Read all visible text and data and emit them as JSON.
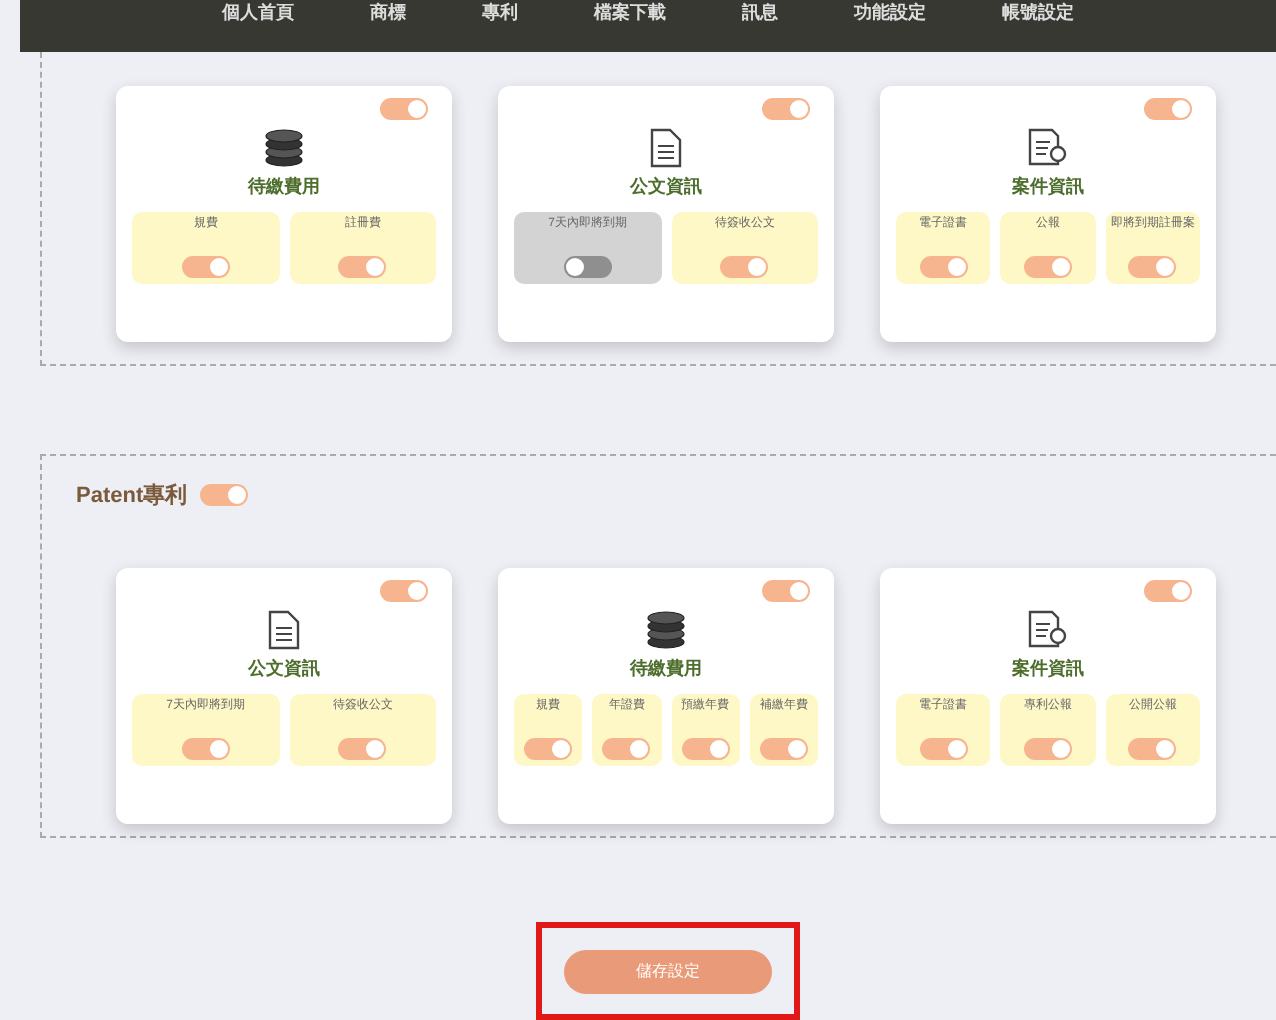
{
  "nav": [
    {
      "label": "個人首頁"
    },
    {
      "label": "商標"
    },
    {
      "label": "專利"
    },
    {
      "label": "檔案下載"
    },
    {
      "label": "訊息"
    },
    {
      "label": "功能設定"
    },
    {
      "label": "帳號設定"
    }
  ],
  "sections": [
    {
      "cards": [
        {
          "kind": "coins",
          "title": "待繳費用",
          "on": true,
          "items": [
            {
              "label": "規費",
              "on": true
            },
            {
              "label": "註冊費",
              "on": true
            }
          ]
        },
        {
          "kind": "document",
          "title": "公文資訊",
          "on": true,
          "items": [
            {
              "label": "7天內即將到期",
              "on": false
            },
            {
              "label": "待簽收公文",
              "on": true
            }
          ]
        },
        {
          "kind": "certificate",
          "title": "案件資訊",
          "on": true,
          "items": [
            {
              "label": "電子證書",
              "on": true
            },
            {
              "label": "公報",
              "on": true
            },
            {
              "label": "即將到期註冊案",
              "on": true
            }
          ]
        }
      ]
    },
    {
      "title": "Patent專利",
      "on": true,
      "cards": [
        {
          "kind": "document",
          "title": "公文資訊",
          "on": true,
          "items": [
            {
              "label": "7天內即將到期",
              "on": true
            },
            {
              "label": "待簽收公文",
              "on": true
            }
          ]
        },
        {
          "kind": "coins",
          "title": "待繳費用",
          "on": true,
          "items": [
            {
              "label": "規費",
              "on": true
            },
            {
              "label": "年證費",
              "on": true
            },
            {
              "label": "預繳年費",
              "on": true
            },
            {
              "label": "補繳年費",
              "on": true
            }
          ]
        },
        {
          "kind": "certificate",
          "title": "案件資訊",
          "on": true,
          "items": [
            {
              "label": "電子證書",
              "on": true
            },
            {
              "label": "專利公報",
              "on": true
            },
            {
              "label": "公開公報",
              "on": true
            }
          ]
        }
      ]
    }
  ],
  "save_button": {
    "label": "儲存設定",
    "highlighted": true
  }
}
